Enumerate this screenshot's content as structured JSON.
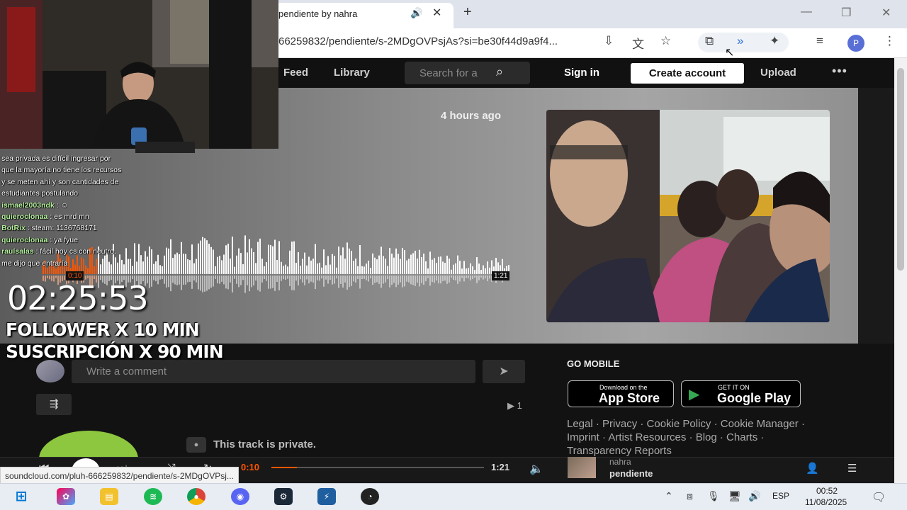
{
  "browser": {
    "tab_title": "pendiente by nahra",
    "tab_audio_icon": "speaker-icon",
    "url": "66259832/pendiente/s-2MDgOVPsjAs?si=be30f44d9a9f4...",
    "status_url": "soundcloud.com/pluh-666259832/pendiente/s-2MDgOVPsj...",
    "profile_initial": "P"
  },
  "nav": {
    "feed": "Feed",
    "library": "Library",
    "search_placeholder": "Search for a",
    "sign_in": "Sign in",
    "create_account": "Create account",
    "upload": "Upload",
    "more": "•••"
  },
  "hero": {
    "time_ago": "4 hours ago",
    "waveform_current": "0:10",
    "waveform_duration": "1:21",
    "progress": 0.12
  },
  "comments": {
    "placeholder": "Write a comment",
    "plays": "1",
    "private_notice": "This track is private."
  },
  "footer": {
    "go_mobile": "GO MOBILE",
    "app_store_small": "Download on the",
    "app_store_big": "App Store",
    "play_small": "GET IT ON",
    "play_big": "Google Play",
    "links_line1": "Legal · Privacy · Cookie Policy · Cookie Manager ·",
    "links_line2": "Imprint · Artist Resources · Blog · Charts ·",
    "links_line3": "Transparency Reports"
  },
  "player": {
    "current": "0:10",
    "duration": "1:21",
    "artist": "nahra",
    "title": "pendiente",
    "progress": 0.12
  },
  "stream": {
    "chat": [
      {
        "user": "",
        "text": "sea privada es difícil ingresar por"
      },
      {
        "user": "",
        "text": "que la mayoría no tiene los recursos"
      },
      {
        "user": "",
        "text": "y se meten ahí y son cantidades de"
      },
      {
        "user": "",
        "text": "estudiantes postulando"
      },
      {
        "user": "ismael2003ndk",
        "text": " : ☺"
      },
      {
        "user": "quieroclonaa",
        "text": " : es mrd mn"
      },
      {
        "user": "BotRix",
        "text": " : steam: 1136768171"
      },
      {
        "user": "quieroclonaa",
        "text": " : ya fyue"
      },
      {
        "user": "raulsalas",
        "text": " : fácil hoy cs con neutro,"
      },
      {
        "user": "",
        "text": "me dijo que entraría"
      }
    ],
    "timer": "02:25:53",
    "goal1": "FOLLOWER X 10 MIN",
    "goal2": "SUSCRIPCIÓN X 90 MIN"
  },
  "taskbar": {
    "lang": "ESP",
    "time": "00:52",
    "date": "11/08/2025"
  },
  "colors": {
    "accent": "#ff5500",
    "green": "#8dc63f"
  }
}
